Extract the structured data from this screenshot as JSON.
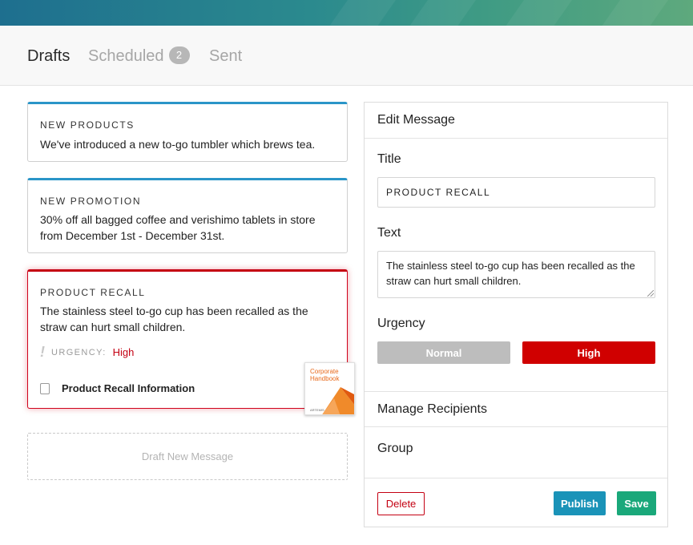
{
  "tabs": [
    {
      "label": "Drafts",
      "active": true
    },
    {
      "label": "Scheduled",
      "badge": "2",
      "active": false
    },
    {
      "label": "Sent",
      "active": false
    }
  ],
  "drafts": [
    {
      "kicker": "NEW PRODUCTS",
      "text": "We've introduced a new to-go tumbler which brews tea."
    },
    {
      "kicker": "NEW PROMOTION",
      "text": "30% off all bagged coffee and verishimo tablets in store from December 1st - December 31st."
    },
    {
      "kicker": "PRODUCT RECALL",
      "text": "The stainless steel to-go cup has been recalled as the straw can hurt small children.",
      "urgency_label": "URGENCY:",
      "urgency_value": "High",
      "attachment_label": "Product Recall Information",
      "attachment_thumb": {
        "title": "Corporate Handbook",
        "footer": "ARTEMIS"
      }
    }
  ],
  "draft_new_label": "Draft New Message",
  "editor": {
    "header": "Edit Message",
    "title_label": "Title",
    "title_value": "PRODUCT RECALL",
    "text_label": "Text",
    "text_value": "The stainless steel to-go cup has been recalled as the straw can hurt small children.",
    "urgency_label": "Urgency",
    "urgency_options": [
      "Normal",
      "High"
    ],
    "urgency_selected": "High",
    "manage_recipients_label": "Manage Recipients",
    "group_label": "Group",
    "delete_label": "Delete",
    "publish_label": "Publish",
    "save_label": "Save"
  },
  "colors": {
    "accent_blue": "#2a95c8",
    "alert_red": "#c40012",
    "publish": "#1a93b8",
    "save": "#1aa87a",
    "normal_gray": "#bdbdbd"
  }
}
